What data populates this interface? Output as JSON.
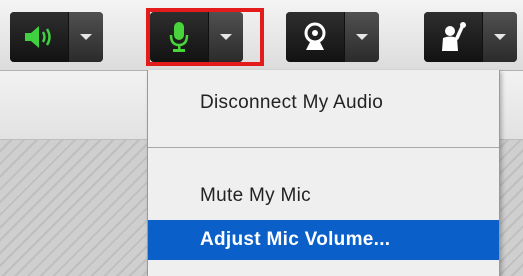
{
  "toolbar": {
    "buttons": [
      {
        "name": "speaker",
        "icon": "speaker-icon",
        "color": "#3fd13f"
      },
      {
        "name": "microphone",
        "icon": "microphone-icon",
        "color": "#48d43a"
      },
      {
        "name": "webcam",
        "icon": "webcam-icon",
        "color": "#ffffff"
      },
      {
        "name": "raise-hand",
        "icon": "raise-hand-icon",
        "color": "#ffffff"
      }
    ],
    "highlight_color": "#e41b1b"
  },
  "menu": {
    "items": [
      {
        "label": "Disconnect My Audio",
        "active": false
      },
      {
        "label": "Mute My Mic",
        "active": false
      },
      {
        "label": "Adjust Mic Volume...",
        "active": true
      }
    ],
    "active_color": "#0a5fc9"
  }
}
